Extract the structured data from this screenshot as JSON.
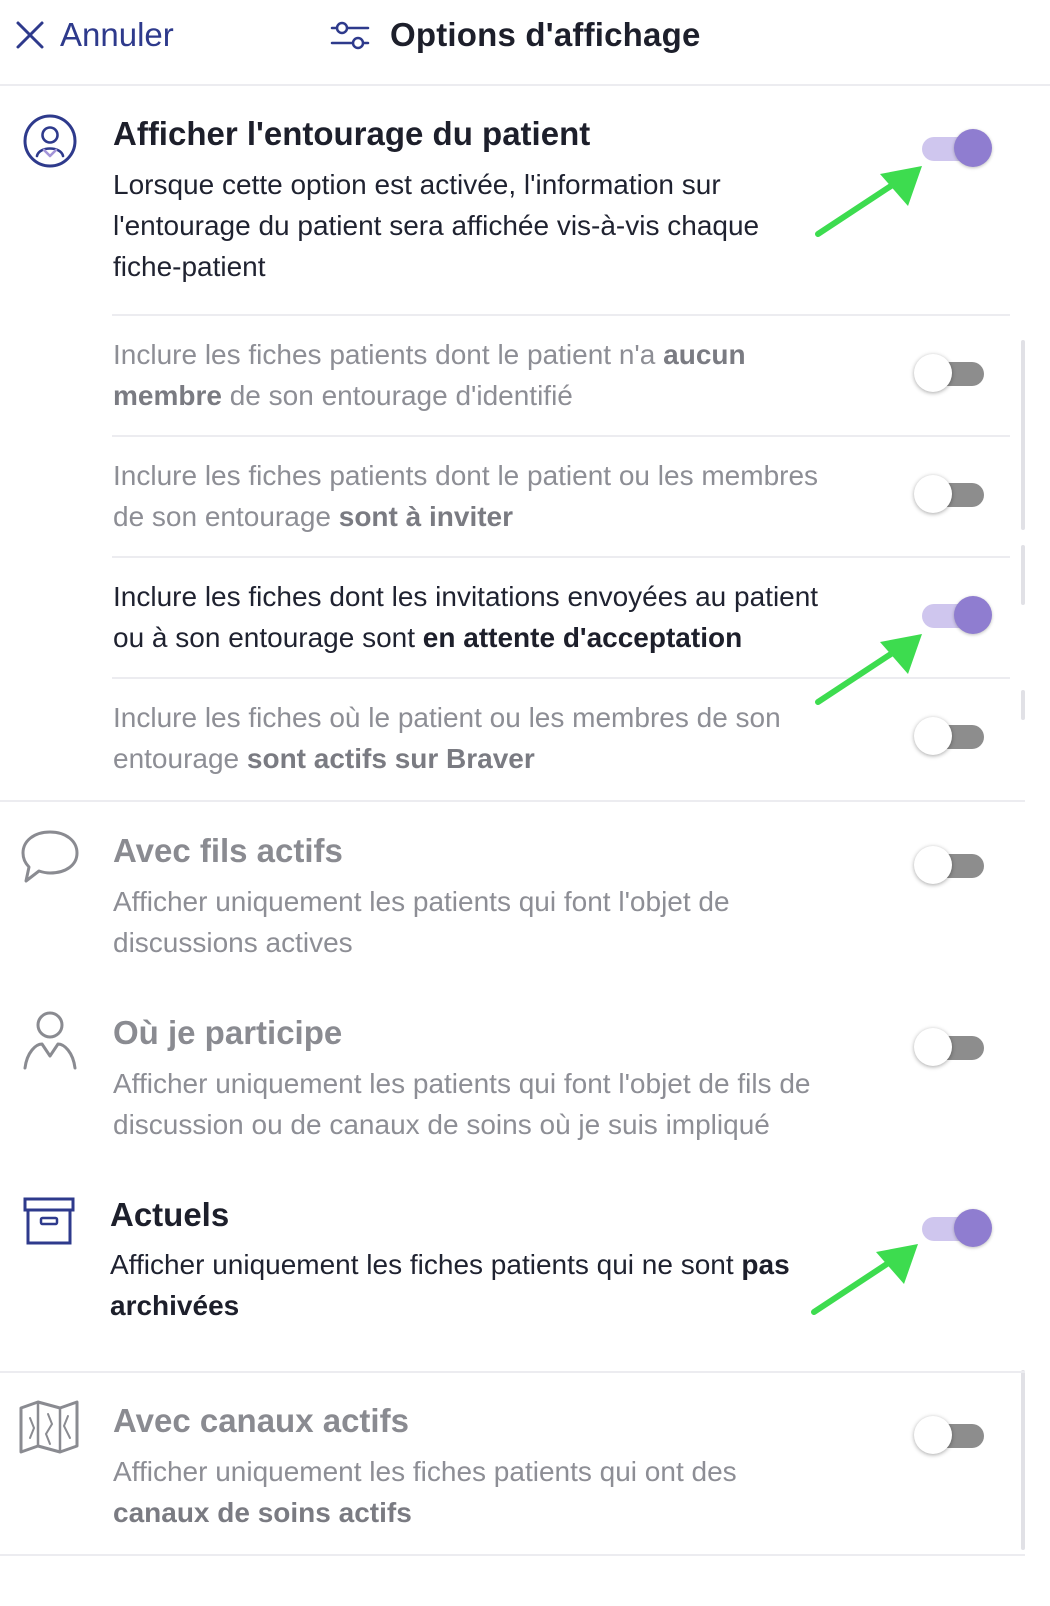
{
  "header": {
    "cancel_label": "Annuler",
    "title": "Options d'affichage"
  },
  "entourage": {
    "title": "Afficher l'entourage du patient",
    "desc_1": "Lorsque cette option est activée, l'information sur",
    "desc_2": "l'entourage du patient sera affichée vis-à-vis chaque",
    "desc_3": "fiche-patient",
    "enabled": true,
    "icon": "user-circle-icon"
  },
  "sub_options": [
    {
      "l1_pre": "Inclure les fiches patients dont le patient n'a ",
      "l1_bold": "aucun",
      "l2_bold": "membre",
      "l2_post": " de son entourage d'identifié",
      "enabled": false
    },
    {
      "l1": "Inclure les fiches patients dont le patient ou les membres",
      "l2_pre": "de son entourage ",
      "l2_bold": "sont à inviter",
      "enabled": false
    },
    {
      "l1": "Inclure les fiches dont les invitations envoyées au patient",
      "l2_pre": "ou à son entourage sont ",
      "l2_bold": "en attente d'acceptation",
      "enabled": true
    },
    {
      "l1": "Inclure les fiches où le patient ou les membres de son",
      "l2_pre": "entourage ",
      "l2_bold": "sont actifs sur Braver",
      "enabled": false
    }
  ],
  "fils": {
    "title": "Avec fils actifs",
    "desc_1": "Afficher uniquement les patients qui font l'objet de",
    "desc_2": "discussions actives",
    "enabled": false,
    "icon": "chat-bubble-icon"
  },
  "participe": {
    "title": "Où je participe",
    "desc_1": "Afficher uniquement les patients qui font l'objet de fils de",
    "desc_2": "discussion ou de canaux de soins où je suis impliqué",
    "enabled": false,
    "icon": "person-icon"
  },
  "actuels": {
    "title": "Actuels",
    "desc_1_pre": "Afficher uniquement les fiches patients qui ne sont ",
    "desc_1_bold": "pas",
    "desc_2_bold": "archivées",
    "enabled": true,
    "icon": "archive-box-icon"
  },
  "canaux": {
    "title": "Avec canaux actifs",
    "desc_1": "Afficher uniquement les fiches patients qui ont des",
    "desc_2_bold": "canaux de soins actifs",
    "enabled": false,
    "icon": "map-icon"
  },
  "colors": {
    "accent": "#8f7dd0",
    "accent_track": "#cfc6ee",
    "link": "#2e3a8c",
    "annotation_arrow": "#3ddc4f"
  }
}
